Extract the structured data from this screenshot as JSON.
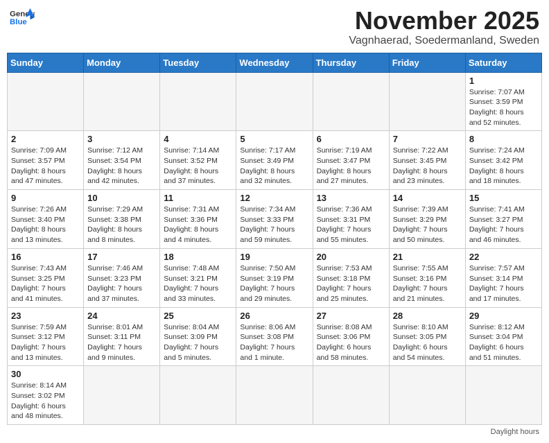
{
  "header": {
    "logo_general": "General",
    "logo_blue": "Blue",
    "month_title": "November 2025",
    "location": "Vagnhaerad, Soedermanland, Sweden"
  },
  "days_of_week": [
    "Sunday",
    "Monday",
    "Tuesday",
    "Wednesday",
    "Thursday",
    "Friday",
    "Saturday"
  ],
  "footer": {
    "note": "Daylight hours"
  },
  "weeks": [
    {
      "days": [
        {
          "num": "",
          "info": "",
          "empty": true
        },
        {
          "num": "",
          "info": "",
          "empty": true
        },
        {
          "num": "",
          "info": "",
          "empty": true
        },
        {
          "num": "",
          "info": "",
          "empty": true
        },
        {
          "num": "",
          "info": "",
          "empty": true
        },
        {
          "num": "",
          "info": "",
          "empty": true
        },
        {
          "num": "1",
          "info": "Sunrise: 7:07 AM\nSunset: 3:59 PM\nDaylight: 8 hours\nand 52 minutes."
        }
      ]
    },
    {
      "days": [
        {
          "num": "2",
          "info": "Sunrise: 7:09 AM\nSunset: 3:57 PM\nDaylight: 8 hours\nand 47 minutes."
        },
        {
          "num": "3",
          "info": "Sunrise: 7:12 AM\nSunset: 3:54 PM\nDaylight: 8 hours\nand 42 minutes."
        },
        {
          "num": "4",
          "info": "Sunrise: 7:14 AM\nSunset: 3:52 PM\nDaylight: 8 hours\nand 37 minutes."
        },
        {
          "num": "5",
          "info": "Sunrise: 7:17 AM\nSunset: 3:49 PM\nDaylight: 8 hours\nand 32 minutes."
        },
        {
          "num": "6",
          "info": "Sunrise: 7:19 AM\nSunset: 3:47 PM\nDaylight: 8 hours\nand 27 minutes."
        },
        {
          "num": "7",
          "info": "Sunrise: 7:22 AM\nSunset: 3:45 PM\nDaylight: 8 hours\nand 23 minutes."
        },
        {
          "num": "8",
          "info": "Sunrise: 7:24 AM\nSunset: 3:42 PM\nDaylight: 8 hours\nand 18 minutes."
        }
      ]
    },
    {
      "days": [
        {
          "num": "9",
          "info": "Sunrise: 7:26 AM\nSunset: 3:40 PM\nDaylight: 8 hours\nand 13 minutes."
        },
        {
          "num": "10",
          "info": "Sunrise: 7:29 AM\nSunset: 3:38 PM\nDaylight: 8 hours\nand 8 minutes."
        },
        {
          "num": "11",
          "info": "Sunrise: 7:31 AM\nSunset: 3:36 PM\nDaylight: 8 hours\nand 4 minutes."
        },
        {
          "num": "12",
          "info": "Sunrise: 7:34 AM\nSunset: 3:33 PM\nDaylight: 7 hours\nand 59 minutes."
        },
        {
          "num": "13",
          "info": "Sunrise: 7:36 AM\nSunset: 3:31 PM\nDaylight: 7 hours\nand 55 minutes."
        },
        {
          "num": "14",
          "info": "Sunrise: 7:39 AM\nSunset: 3:29 PM\nDaylight: 7 hours\nand 50 minutes."
        },
        {
          "num": "15",
          "info": "Sunrise: 7:41 AM\nSunset: 3:27 PM\nDaylight: 7 hours\nand 46 minutes."
        }
      ]
    },
    {
      "days": [
        {
          "num": "16",
          "info": "Sunrise: 7:43 AM\nSunset: 3:25 PM\nDaylight: 7 hours\nand 41 minutes."
        },
        {
          "num": "17",
          "info": "Sunrise: 7:46 AM\nSunset: 3:23 PM\nDaylight: 7 hours\nand 37 minutes."
        },
        {
          "num": "18",
          "info": "Sunrise: 7:48 AM\nSunset: 3:21 PM\nDaylight: 7 hours\nand 33 minutes."
        },
        {
          "num": "19",
          "info": "Sunrise: 7:50 AM\nSunset: 3:19 PM\nDaylight: 7 hours\nand 29 minutes."
        },
        {
          "num": "20",
          "info": "Sunrise: 7:53 AM\nSunset: 3:18 PM\nDaylight: 7 hours\nand 25 minutes."
        },
        {
          "num": "21",
          "info": "Sunrise: 7:55 AM\nSunset: 3:16 PM\nDaylight: 7 hours\nand 21 minutes."
        },
        {
          "num": "22",
          "info": "Sunrise: 7:57 AM\nSunset: 3:14 PM\nDaylight: 7 hours\nand 17 minutes."
        }
      ]
    },
    {
      "days": [
        {
          "num": "23",
          "info": "Sunrise: 7:59 AM\nSunset: 3:12 PM\nDaylight: 7 hours\nand 13 minutes."
        },
        {
          "num": "24",
          "info": "Sunrise: 8:01 AM\nSunset: 3:11 PM\nDaylight: 7 hours\nand 9 minutes."
        },
        {
          "num": "25",
          "info": "Sunrise: 8:04 AM\nSunset: 3:09 PM\nDaylight: 7 hours\nand 5 minutes."
        },
        {
          "num": "26",
          "info": "Sunrise: 8:06 AM\nSunset: 3:08 PM\nDaylight: 7 hours\nand 1 minute."
        },
        {
          "num": "27",
          "info": "Sunrise: 8:08 AM\nSunset: 3:06 PM\nDaylight: 6 hours\nand 58 minutes."
        },
        {
          "num": "28",
          "info": "Sunrise: 8:10 AM\nSunset: 3:05 PM\nDaylight: 6 hours\nand 54 minutes."
        },
        {
          "num": "29",
          "info": "Sunrise: 8:12 AM\nSunset: 3:04 PM\nDaylight: 6 hours\nand 51 minutes."
        }
      ]
    },
    {
      "days": [
        {
          "num": "30",
          "info": "Sunrise: 8:14 AM\nSunset: 3:02 PM\nDaylight: 6 hours\nand 48 minutes."
        },
        {
          "num": "",
          "info": "",
          "empty": true
        },
        {
          "num": "",
          "info": "",
          "empty": true
        },
        {
          "num": "",
          "info": "",
          "empty": true
        },
        {
          "num": "",
          "info": "",
          "empty": true
        },
        {
          "num": "",
          "info": "",
          "empty": true
        },
        {
          "num": "",
          "info": "",
          "empty": true
        }
      ]
    }
  ]
}
